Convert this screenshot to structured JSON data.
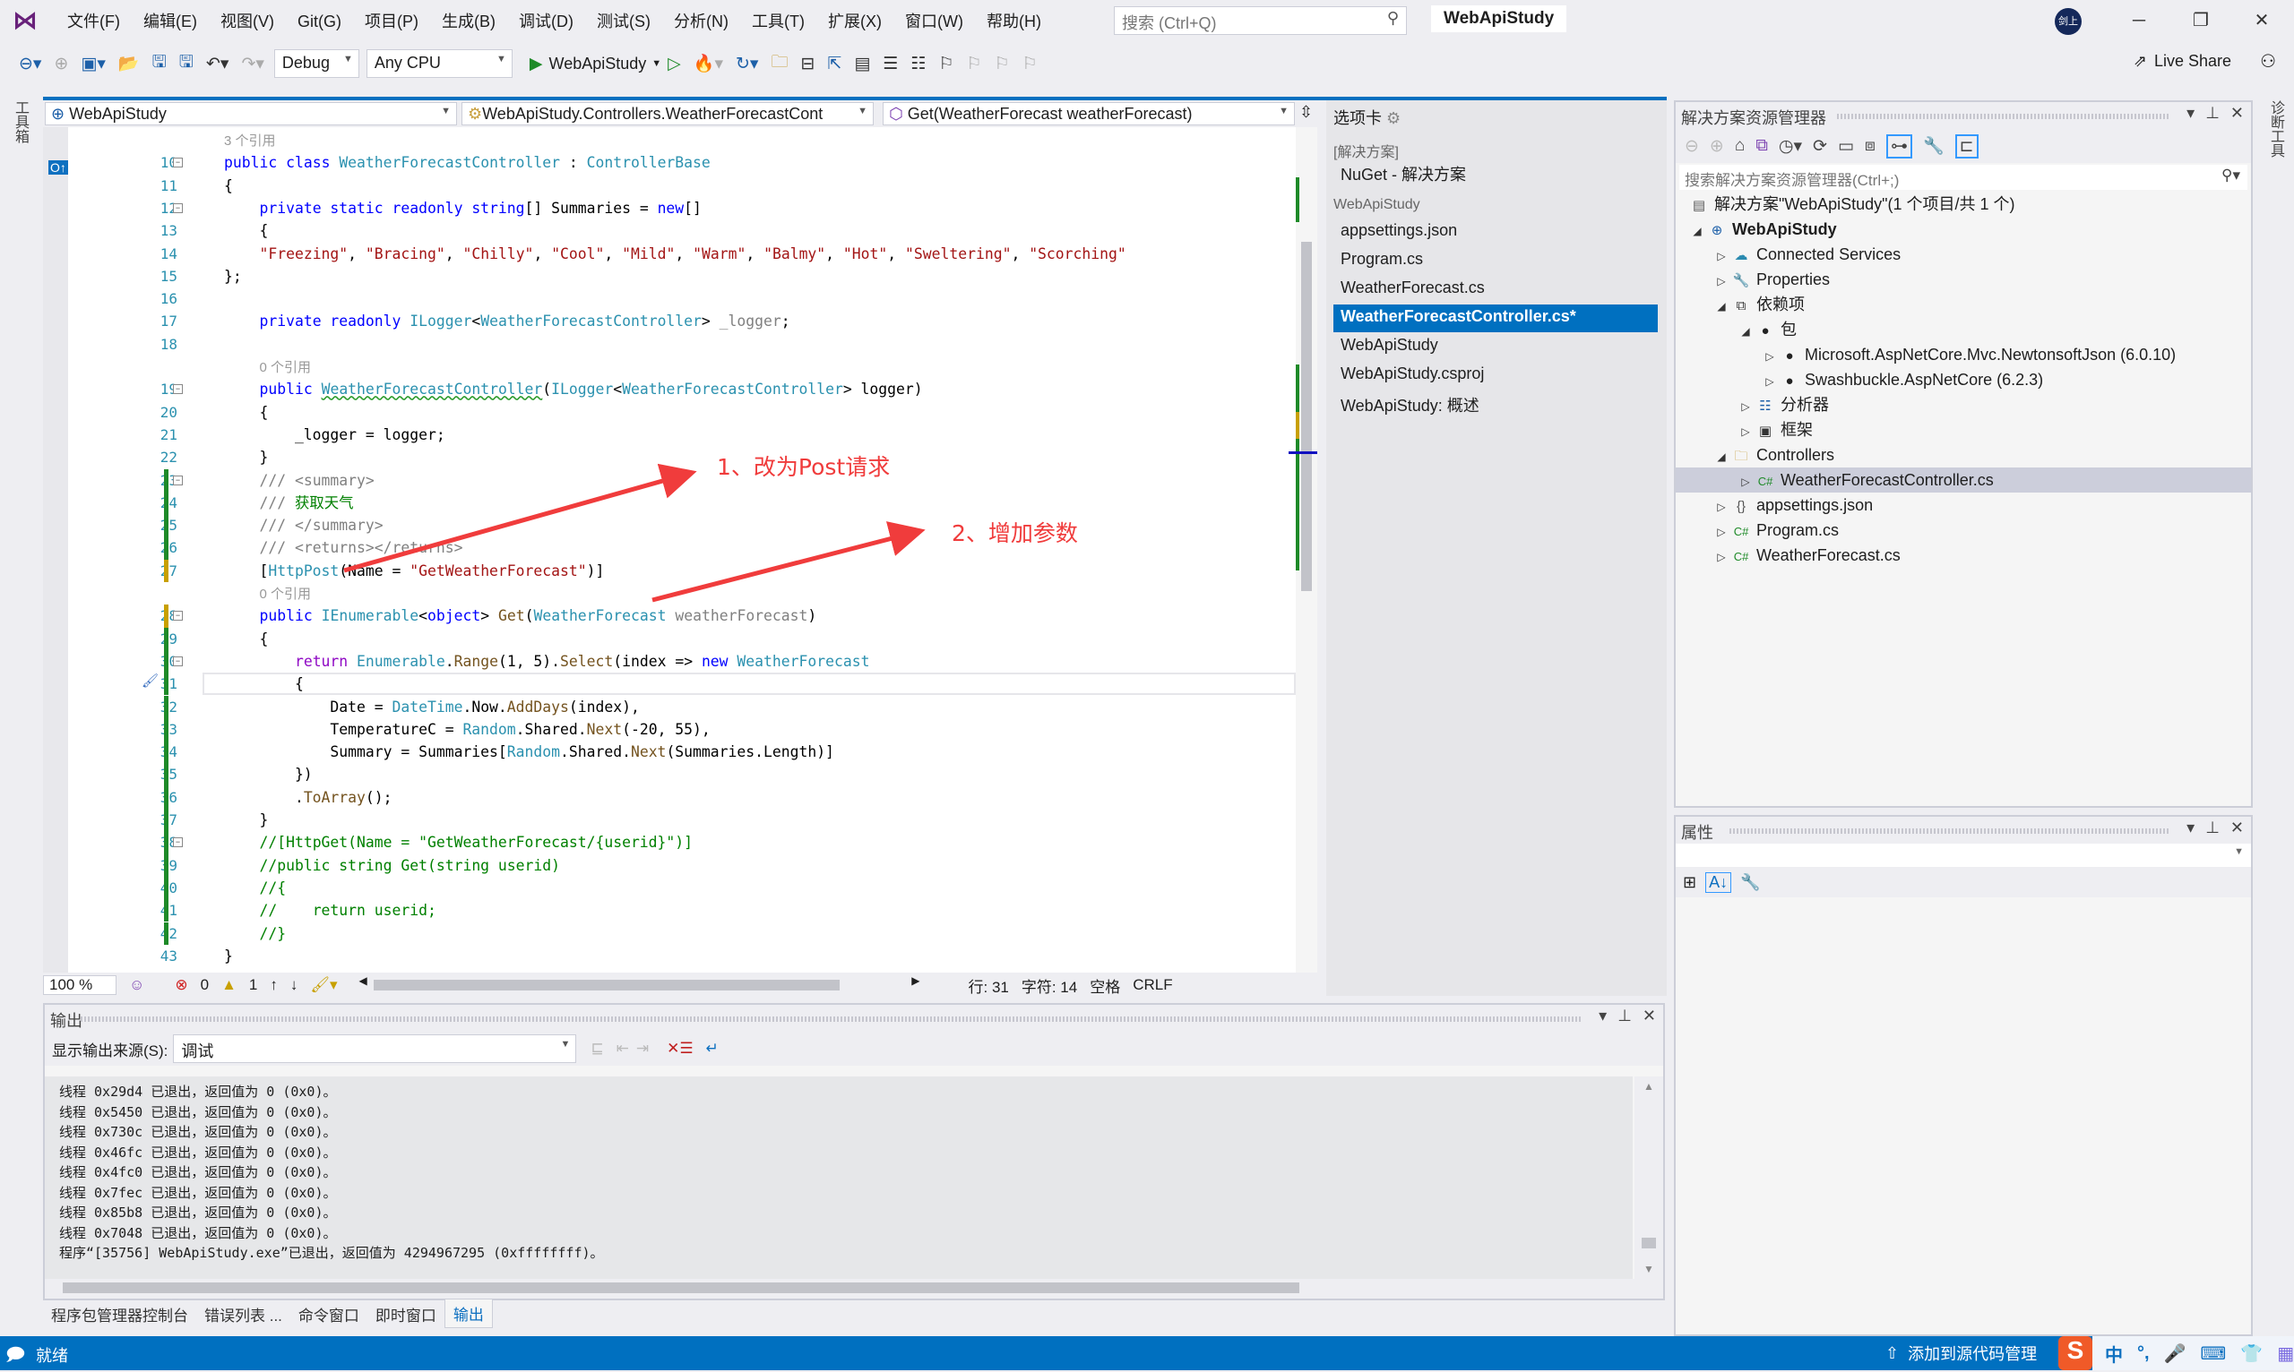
{
  "app": {
    "title": "WebApiStudy",
    "menu": [
      "文件(F)",
      "编辑(E)",
      "视图(V)",
      "Git(G)",
      "项目(P)",
      "生成(B)",
      "调试(D)",
      "测试(S)",
      "分析(N)",
      "工具(T)",
      "扩展(X)",
      "窗口(W)",
      "帮助(H)"
    ],
    "search_placeholder": "搜索 (Ctrl+Q)",
    "avatar_text": "剑上",
    "accent": "#0070c0"
  },
  "toolbar": {
    "config": "Debug",
    "platform": "Any CPU",
    "run_target": "WebApiStudy",
    "live_share": "Live Share"
  },
  "side_strips": {
    "left": "工具箱",
    "right": "诊断工具"
  },
  "editor": {
    "nav": {
      "project": "WebApiStudy",
      "class": "WebApiStudy.Controllers.WeatherForecastCont",
      "member": "Get(WeatherForecast weatherForecast)"
    },
    "lines": [
      {
        "n": "",
        "lens": true,
        "tokens": [
          [
            "cl",
            "3 个引用"
          ]
        ]
      },
      {
        "n": "10",
        "tokens": [
          [
            "k",
            "public"
          ],
          [
            "p",
            " "
          ],
          [
            "k",
            "class"
          ],
          [
            "p",
            " "
          ],
          [
            "t",
            "WeatherForecastController"
          ],
          [
            "p",
            " : "
          ],
          [
            "t",
            "ControllerBase"
          ]
        ]
      },
      {
        "n": "11",
        "tokens": [
          [
            "p",
            "{"
          ]
        ]
      },
      {
        "n": "12",
        "tokens": [
          [
            "p",
            "    "
          ],
          [
            "k",
            "private static readonly string"
          ],
          [
            "p",
            "[] Summaries = "
          ],
          [
            "k",
            "new"
          ],
          [
            "p",
            "[]"
          ]
        ]
      },
      {
        "n": "13",
        "tokens": [
          [
            "p",
            "    {"
          ]
        ]
      },
      {
        "n": "14",
        "tokens": [
          [
            "p",
            "    "
          ],
          [
            "s",
            "\"Freezing\""
          ],
          [
            "p",
            ", "
          ],
          [
            "s",
            "\"Bracing\""
          ],
          [
            "p",
            ", "
          ],
          [
            "s",
            "\"Chilly\""
          ],
          [
            "p",
            ", "
          ],
          [
            "s",
            "\"Cool\""
          ],
          [
            "p",
            ", "
          ],
          [
            "s",
            "\"Mild\""
          ],
          [
            "p",
            ", "
          ],
          [
            "s",
            "\"Warm\""
          ],
          [
            "p",
            ", "
          ],
          [
            "s",
            "\"Balmy\""
          ],
          [
            "p",
            ", "
          ],
          [
            "s",
            "\"Hot\""
          ],
          [
            "p",
            ", "
          ],
          [
            "s",
            "\"Sweltering\""
          ],
          [
            "p",
            ", "
          ],
          [
            "s",
            "\"Scorching\""
          ]
        ]
      },
      {
        "n": "15",
        "tokens": [
          [
            "p",
            "};"
          ]
        ]
      },
      {
        "n": "16",
        "tokens": []
      },
      {
        "n": "17",
        "tokens": [
          [
            "p",
            "    "
          ],
          [
            "k",
            "private readonly"
          ],
          [
            "p",
            " "
          ],
          [
            "t",
            "ILogger"
          ],
          [
            "p",
            "<"
          ],
          [
            "t",
            "WeatherForecastController"
          ],
          [
            "p",
            "> "
          ],
          [
            "g",
            "_logger"
          ],
          [
            "p",
            ";"
          ]
        ]
      },
      {
        "n": "18",
        "tokens": []
      },
      {
        "n": "",
        "lens": true,
        "tokens": [
          [
            "p",
            "    "
          ],
          [
            "cl",
            "0 个引用"
          ]
        ]
      },
      {
        "n": "19",
        "tokens": [
          [
            "p",
            "    "
          ],
          [
            "k",
            "public"
          ],
          [
            "p",
            " "
          ],
          [
            "tsq",
            "WeatherForecastController"
          ],
          [
            "p",
            "("
          ],
          [
            "t",
            "ILogger"
          ],
          [
            "p",
            "<"
          ],
          [
            "t",
            "WeatherForecastController"
          ],
          [
            "p",
            "> logger)"
          ]
        ]
      },
      {
        "n": "20",
        "tokens": [
          [
            "p",
            "    {"
          ]
        ]
      },
      {
        "n": "21",
        "tokens": [
          [
            "p",
            "        _logger = logger;"
          ]
        ]
      },
      {
        "n": "22",
        "tokens": [
          [
            "p",
            "    }"
          ]
        ]
      },
      {
        "n": "23",
        "tokens": [
          [
            "p",
            "    "
          ],
          [
            "dc",
            "/// <summary>"
          ]
        ]
      },
      {
        "n": "24",
        "tokens": [
          [
            "p",
            "    "
          ],
          [
            "dc",
            "/// "
          ],
          [
            "c",
            "获取天气"
          ]
        ]
      },
      {
        "n": "25",
        "tokens": [
          [
            "p",
            "    "
          ],
          [
            "dc",
            "/// </summary>"
          ]
        ]
      },
      {
        "n": "26",
        "tokens": [
          [
            "p",
            "    "
          ],
          [
            "dc",
            "/// <returns></returns>"
          ]
        ]
      },
      {
        "n": "27",
        "tokens": [
          [
            "p",
            "    ["
          ],
          [
            "t",
            "HttpPost"
          ],
          [
            "p",
            "(Name = "
          ],
          [
            "s",
            "\"GetWeatherForecast\""
          ],
          [
            "p",
            ")]"
          ]
        ]
      },
      {
        "n": "",
        "lens": true,
        "tokens": [
          [
            "p",
            "    "
          ],
          [
            "cl",
            "0 个引用"
          ]
        ]
      },
      {
        "n": "28",
        "tokens": [
          [
            "p",
            "    "
          ],
          [
            "k",
            "public"
          ],
          [
            "p",
            " "
          ],
          [
            "t",
            "IEnumerable"
          ],
          [
            "p",
            "<"
          ],
          [
            "k",
            "object"
          ],
          [
            "p",
            "> "
          ],
          [
            "m",
            "Get"
          ],
          [
            "p",
            "("
          ],
          [
            "t",
            "WeatherForecast"
          ],
          [
            "p",
            " "
          ],
          [
            "g",
            "weatherForecast"
          ],
          [
            "p",
            ")"
          ]
        ]
      },
      {
        "n": "29",
        "tokens": [
          [
            "p",
            "    {"
          ]
        ]
      },
      {
        "n": "30",
        "tokens": [
          [
            "p",
            "        "
          ],
          [
            "r",
            "return"
          ],
          [
            "p",
            " "
          ],
          [
            "t",
            "Enumerable"
          ],
          [
            "p",
            "."
          ],
          [
            "m",
            "Range"
          ],
          [
            "p",
            "(1, 5)."
          ],
          [
            "m",
            "Select"
          ],
          [
            "p",
            "(index => "
          ],
          [
            "k",
            "new"
          ],
          [
            "p",
            " "
          ],
          [
            "t",
            "WeatherForecast"
          ]
        ]
      },
      {
        "n": "31",
        "current": true,
        "tokens": [
          [
            "p",
            "        {"
          ]
        ]
      },
      {
        "n": "32",
        "tokens": [
          [
            "p",
            "            Date = "
          ],
          [
            "t",
            "DateTime"
          ],
          [
            "p",
            ".Now."
          ],
          [
            "m",
            "AddDays"
          ],
          [
            "p",
            "(index),"
          ]
        ]
      },
      {
        "n": "33",
        "tokens": [
          [
            "p",
            "            TemperatureC = "
          ],
          [
            "t",
            "Random"
          ],
          [
            "p",
            ".Shared."
          ],
          [
            "m",
            "Next"
          ],
          [
            "p",
            "(-20, 55),"
          ]
        ]
      },
      {
        "n": "34",
        "tokens": [
          [
            "p",
            "            Summary = Summaries["
          ],
          [
            "t",
            "Random"
          ],
          [
            "p",
            ".Shared."
          ],
          [
            "m",
            "Next"
          ],
          [
            "p",
            "(Summaries.Length)]"
          ]
        ]
      },
      {
        "n": "35",
        "tokens": [
          [
            "p",
            "        })"
          ]
        ]
      },
      {
        "n": "36",
        "tokens": [
          [
            "p",
            "        ."
          ],
          [
            "m",
            "ToArray"
          ],
          [
            "p",
            "();"
          ]
        ]
      },
      {
        "n": "37",
        "tokens": [
          [
            "p",
            "    }"
          ]
        ]
      },
      {
        "n": "38",
        "tokens": [
          [
            "p",
            "    "
          ],
          [
            "c",
            "//[HttpGet(Name = \"GetWeatherForecast/{userid}\")]"
          ]
        ]
      },
      {
        "n": "39",
        "tokens": [
          [
            "p",
            "    "
          ],
          [
            "c",
            "//public string Get(string userid)"
          ]
        ]
      },
      {
        "n": "40",
        "tokens": [
          [
            "p",
            "    "
          ],
          [
            "c",
            "//{"
          ]
        ]
      },
      {
        "n": "41",
        "tokens": [
          [
            "p",
            "    "
          ],
          [
            "c",
            "//    return userid;"
          ]
        ]
      },
      {
        "n": "42",
        "tokens": [
          [
            "p",
            "    "
          ],
          [
            "c",
            "//}"
          ]
        ]
      },
      {
        "n": "43",
        "tokens": [
          [
            "p",
            "}"
          ]
        ]
      }
    ],
    "annotations": [
      "1、改为Post请求",
      "2、增加参数"
    ],
    "status": {
      "zoom": "100 %",
      "errors": "0",
      "warnings": "1",
      "line": "行: 31",
      "char": "字符: 14",
      "whitespace": "空格",
      "eol": "CRLF"
    }
  },
  "tabs_panel": {
    "title": "选项卡",
    "groups": [
      {
        "label": "[解决方案]",
        "items": [
          "NuGet - 解决方案"
        ]
      },
      {
        "label": "WebApiStudy",
        "items": [
          "appsettings.json",
          "Program.cs",
          "WeatherForecast.cs",
          "WeatherForecastController.cs*",
          "WebApiStudy",
          "WebApiStudy.csproj",
          "WebApiStudy: 概述"
        ]
      }
    ],
    "selected": "WeatherForecastController.cs*"
  },
  "solution_explorer": {
    "title": "解决方案资源管理器",
    "search_placeholder": "搜索解决方案资源管理器(Ctrl+;)",
    "tree": [
      {
        "label": "解决方案\"WebApiStudy\"(1 个项目/共 1 个)",
        "level": 0,
        "exp": "",
        "icon": "solution-icon"
      },
      {
        "label": "WebApiStudy",
        "level": 1,
        "exp": "open",
        "icon": "web-project-icon",
        "bold": true
      },
      {
        "label": "Connected Services",
        "level": 2,
        "exp": "closed",
        "icon": "connected-services-icon"
      },
      {
        "label": "Properties",
        "level": 2,
        "exp": "closed",
        "icon": "properties-icon"
      },
      {
        "label": "依赖项",
        "level": 2,
        "exp": "open",
        "icon": "dependencies-icon"
      },
      {
        "label": "包",
        "level": 3,
        "exp": "open",
        "icon": "package-icon"
      },
      {
        "label": "Microsoft.AspNetCore.Mvc.NewtonsoftJson (6.0.10)",
        "level": 4,
        "exp": "closed",
        "icon": "package-icon"
      },
      {
        "label": "Swashbuckle.AspNetCore (6.2.3)",
        "level": 4,
        "exp": "closed",
        "icon": "package-icon"
      },
      {
        "label": "分析器",
        "level": 3,
        "exp": "closed",
        "icon": "analyzer-icon"
      },
      {
        "label": "框架",
        "level": 3,
        "exp": "closed",
        "icon": "framework-icon"
      },
      {
        "label": "Controllers",
        "level": 2,
        "exp": "open",
        "icon": "folder-icon"
      },
      {
        "label": "WeatherForecastController.cs",
        "level": 3,
        "exp": "closed",
        "icon": "csharp-icon",
        "selected": true
      },
      {
        "label": "appsettings.json",
        "level": 2,
        "exp": "closed",
        "icon": "json-icon"
      },
      {
        "label": "Program.cs",
        "level": 2,
        "exp": "closed",
        "icon": "csharp-icon"
      },
      {
        "label": "WeatherForecast.cs",
        "level": 2,
        "exp": "closed",
        "icon": "csharp-icon"
      }
    ]
  },
  "properties": {
    "title": "属性"
  },
  "output": {
    "title": "输出",
    "source_label": "显示输出来源(S):",
    "source_value": "调试",
    "lines": [
      "线程 0x29d4 已退出，返回值为 0 (0x0)。",
      "线程 0x5450 已退出，返回值为 0 (0x0)。",
      "线程 0x730c 已退出，返回值为 0 (0x0)。",
      "线程 0x46fc 已退出，返回值为 0 (0x0)。",
      "线程 0x4fc0 已退出，返回值为 0 (0x0)。",
      "线程 0x7fec 已退出，返回值为 0 (0x0)。",
      "线程 0x85b8 已退出，返回值为 0 (0x0)。",
      "线程 0x7048 已退出，返回值为 0 (0x0)。",
      "程序“[35756] WebApiStudy.exe”已退出，返回值为 4294967295 (0xffffffff)。"
    ]
  },
  "bottom_tabs": [
    "程序包管理器控制台",
    "错误列表 ...",
    "命令窗口",
    "即时窗口",
    "输出"
  ],
  "bottom_tabs_active": "输出",
  "statusbar": {
    "ready": "就绪",
    "source_control": "添加到源代码管理",
    "ime": [
      "中",
      "°,"
    ]
  }
}
